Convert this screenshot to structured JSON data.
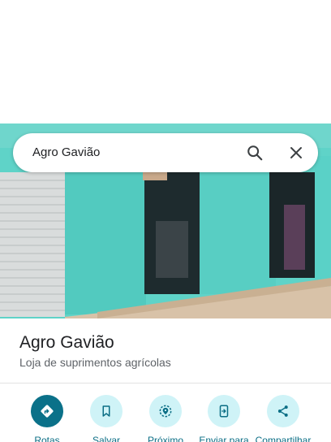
{
  "search": {
    "query": "Agro Gavião",
    "search_icon": "search-icon",
    "close_icon": "close-icon"
  },
  "photo": {
    "description_icon": "storefront-photo"
  },
  "place": {
    "name": "Agro Gavião",
    "category": "Loja de suprimentos agrícolas"
  },
  "actions": [
    {
      "label": "Rotas",
      "icon": "directions-icon",
      "primary": true
    },
    {
      "label": "Salvar",
      "icon": "bookmark-icon",
      "primary": false
    },
    {
      "label": "Próximo",
      "icon": "nearby-icon",
      "primary": false
    },
    {
      "label": "Enviar para",
      "icon": "send-to-phone-icon",
      "primary": false
    },
    {
      "label": "Compartilhar",
      "icon": "share-icon",
      "primary": false
    }
  ],
  "colors": {
    "accent": "#0b7189",
    "action_bg": "#cff3f7",
    "wall": "#5fd3c8"
  }
}
